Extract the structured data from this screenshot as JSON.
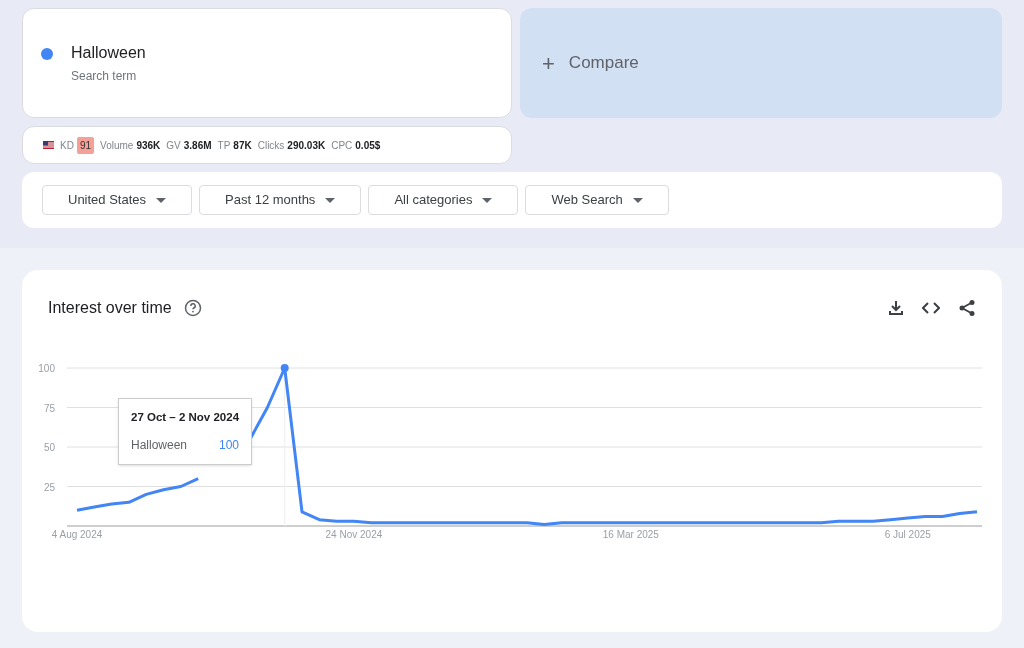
{
  "term": {
    "name": "Halloween",
    "subtitle": "Search term",
    "color": "#4285f4"
  },
  "compare": {
    "icon": "+",
    "label": "Compare"
  },
  "metrics": [
    {
      "label": "KD",
      "value": "91",
      "kind": "badge"
    },
    {
      "label": "Volume",
      "value": "936K",
      "kind": "plain"
    },
    {
      "label": "GV",
      "value": "3.86M",
      "kind": "plain"
    },
    {
      "label": "TP",
      "value": "87K",
      "kind": "plain"
    },
    {
      "label": "Clicks",
      "value": "290.03K",
      "kind": "plain"
    },
    {
      "label": "CPC",
      "value": "0.05$",
      "kind": "plain"
    }
  ],
  "filters": [
    "United States",
    "Past 12 months",
    "All categories",
    "Web Search"
  ],
  "panel": {
    "title": "Interest over time",
    "tooltip": {
      "date": "27 Oct – 2 Nov 2024",
      "value": "100"
    },
    "chart_data": {
      "type": "line",
      "categories": [
        "4 Aug 2024",
        null,
        null,
        null,
        null,
        null,
        null,
        null,
        null,
        null,
        null,
        null,
        null,
        null,
        null,
        null,
        "24 Nov 2024",
        null,
        null,
        null,
        null,
        null,
        null,
        null,
        null,
        null,
        null,
        null,
        null,
        null,
        null,
        null,
        "16 Mar 2025",
        null,
        null,
        null,
        null,
        null,
        null,
        null,
        null,
        null,
        null,
        null,
        null,
        null,
        null,
        null,
        "6 Jul 2025",
        null,
        null,
        null,
        null
      ],
      "series": [
        {
          "name": "Halloween",
          "color": "#4285f4",
          "values": [
            10,
            12,
            14,
            15,
            20,
            23,
            25,
            30,
            null,
            null,
            55,
            75,
            100,
            9,
            4,
            3,
            3,
            2,
            2,
            2,
            2,
            2,
            2,
            2,
            2,
            2,
            2,
            1,
            2,
            2,
            2,
            2,
            2,
            2,
            2,
            2,
            2,
            2,
            2,
            2,
            2,
            2,
            2,
            2,
            3,
            3,
            3,
            4,
            5,
            6,
            6,
            8,
            9
          ]
        }
      ],
      "ylim": [
        0,
        100
      ],
      "grid": true,
      "yticks": [
        25,
        50,
        75,
        100
      ]
    }
  }
}
